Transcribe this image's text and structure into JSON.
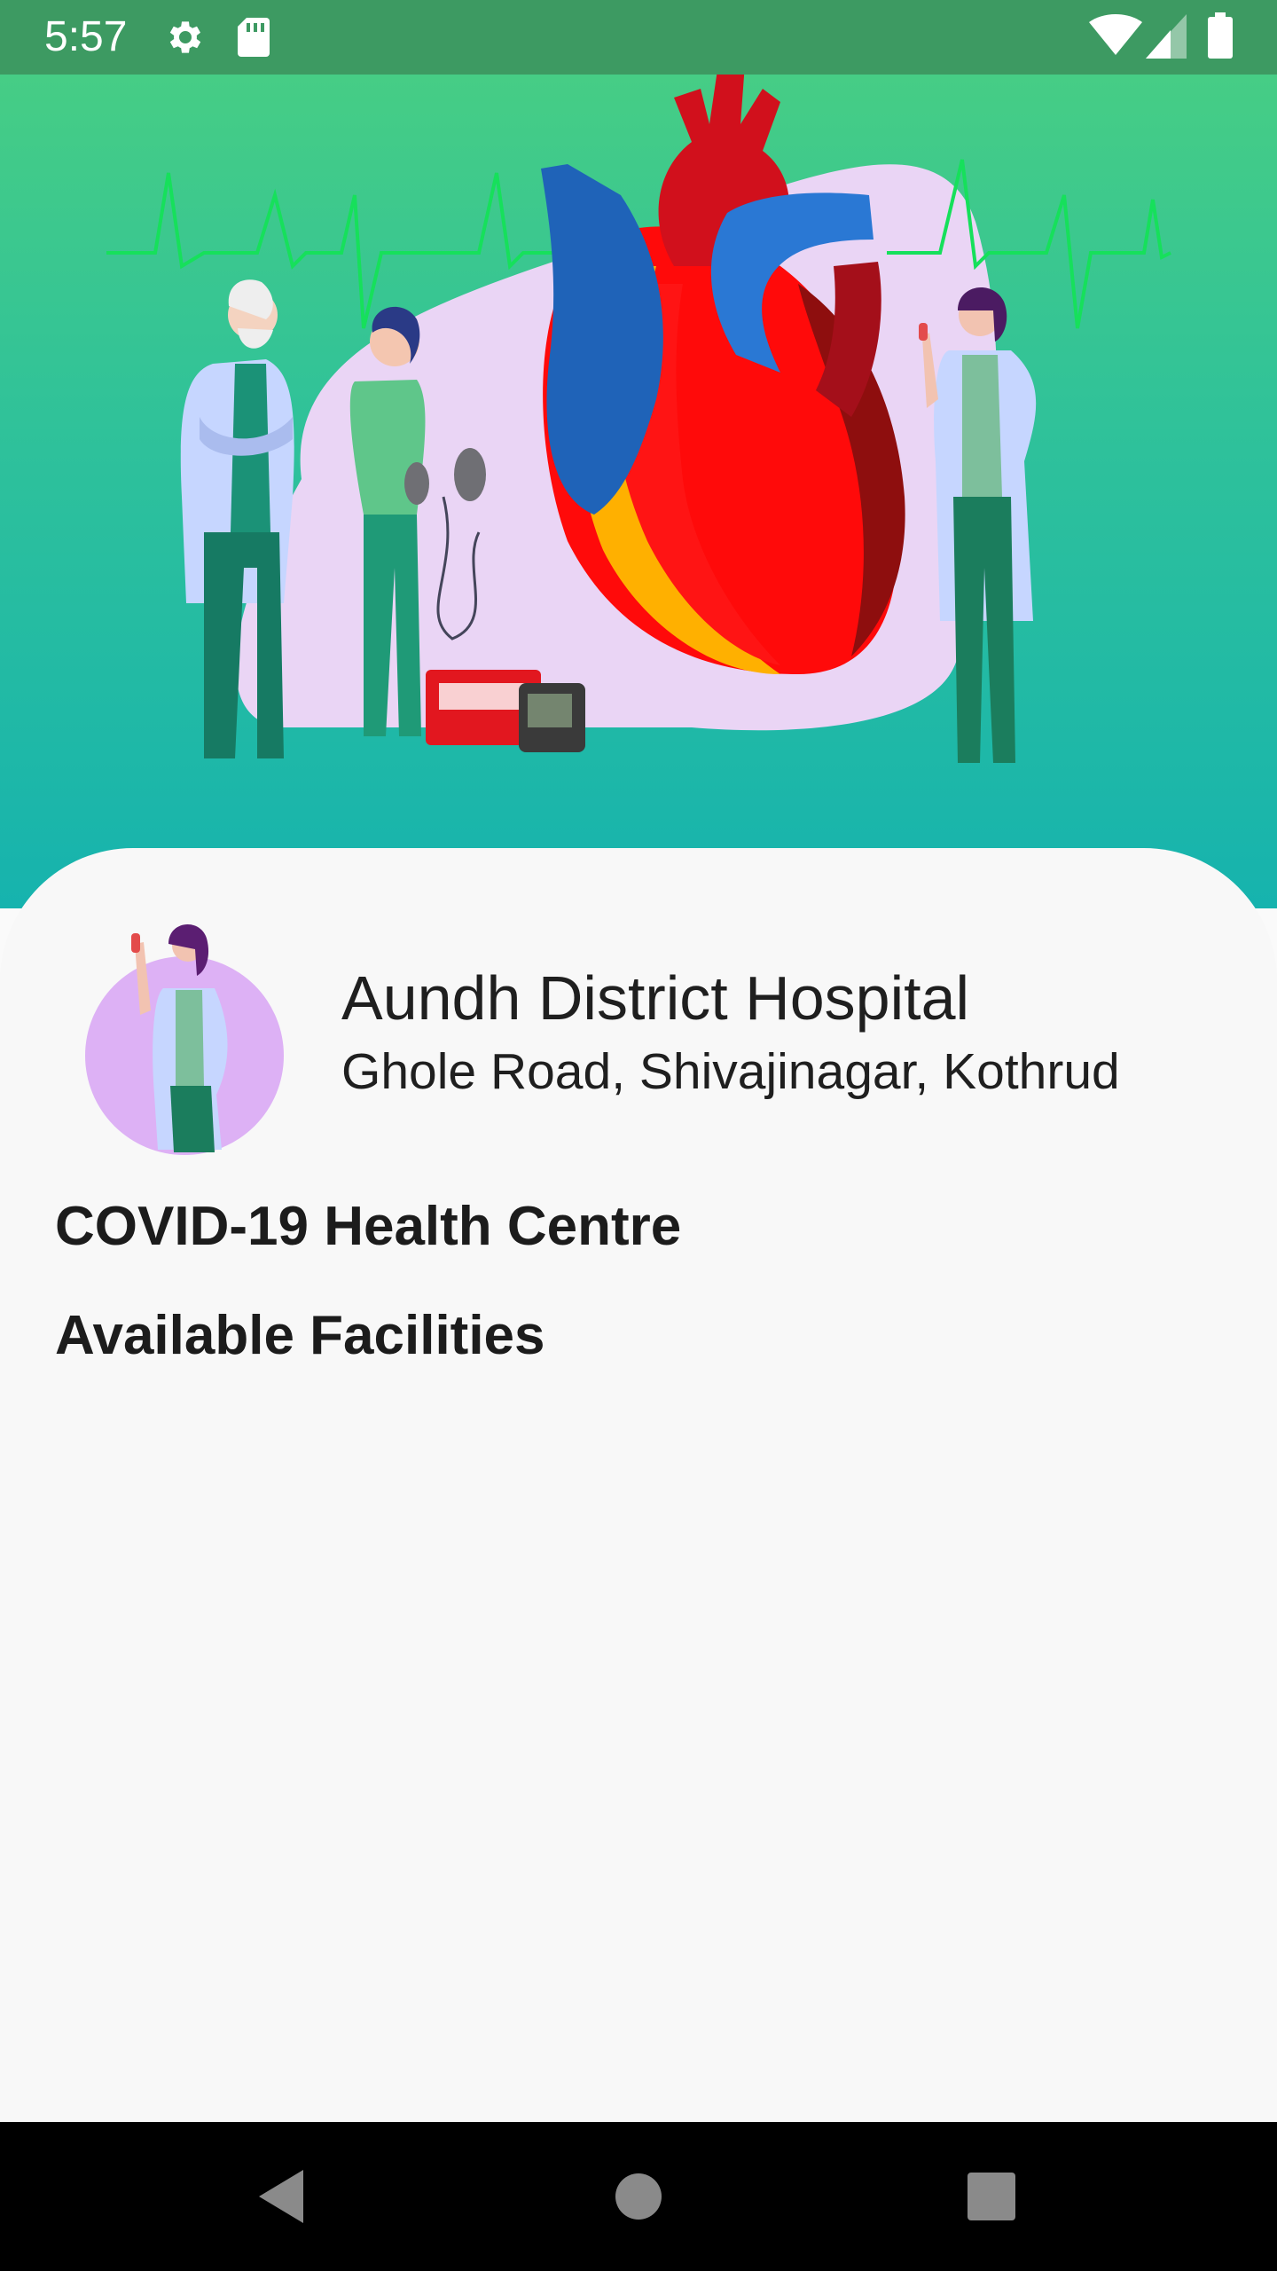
{
  "status_bar": {
    "time": "5:57",
    "icons": [
      "settings-icon",
      "sd-card-icon",
      "wifi-icon",
      "cell-signal-icon",
      "battery-icon"
    ],
    "color": "#3d9a62"
  },
  "hero": {
    "illustration": "cardiology-doctors-heart-illustration",
    "gradient_top": "#46cd85",
    "gradient_bottom": "#16b3ae"
  },
  "hospital": {
    "name": "Aundh District Hospital",
    "address": "Ghole Road, Shivajinagar, Kothrud",
    "avatar_icon": "doctor-avatar-icon"
  },
  "main": {
    "centre_type": "COVID-19 Health Centre",
    "facilities_heading": "Available Facilities"
  },
  "nav_bar": {
    "buttons": [
      "back-icon",
      "home-icon",
      "recents-icon"
    ]
  }
}
